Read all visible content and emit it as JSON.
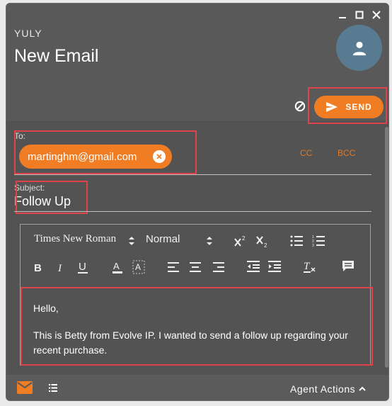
{
  "window": {
    "user_name": "YULY",
    "title": "New Email",
    "controls": [
      "minimize-icon",
      "maximize-icon",
      "close-icon"
    ]
  },
  "actions": {
    "send_label": "SEND",
    "send_color": "#f07d24"
  },
  "compose": {
    "to_label": "To:",
    "recipients": [
      "martinghm@gmail.com"
    ],
    "cc_label": "CC",
    "bcc_label": "BCC",
    "subject_label": "Subject:",
    "subject_value": "Follow Up"
  },
  "editor": {
    "font": "Times New Roman",
    "size": "Normal",
    "toolbar_buttons": [
      "superscript",
      "subscript",
      "bullet-list",
      "numbered-list",
      "bold",
      "italic",
      "underline",
      "font-color",
      "highlight-color",
      "align-left",
      "align-center",
      "align-right",
      "outdent",
      "indent",
      "clear-formatting",
      "comment"
    ],
    "body_lines": [
      "Hello,",
      "This is Betty from Evolve IP.  I wanted to send a follow up regarding your recent purchase."
    ]
  },
  "footer": {
    "agent_actions_label": "Agent Actions"
  }
}
